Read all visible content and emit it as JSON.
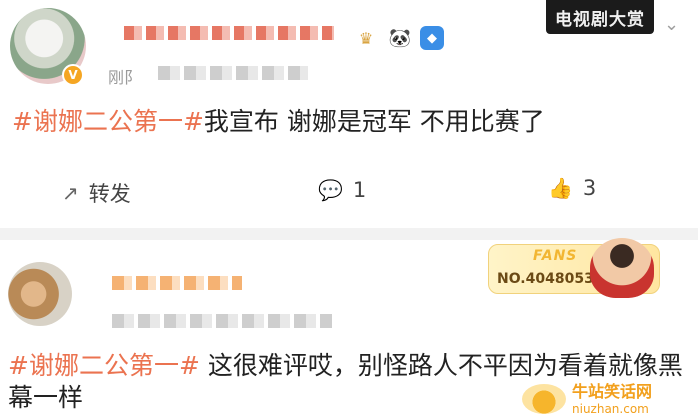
{
  "post1": {
    "time_partial": "刚阝",
    "award_logo_text": "电视剧大赏",
    "content_tag": "#谢娜二公第一#",
    "content_text": "我宣布 谢娜是冠军 不用比赛了",
    "actions": {
      "repost_label": "转发",
      "comment_count": "1",
      "like_count": "3"
    },
    "icons": [
      "repost-icon",
      "comment-icon",
      "like-icon",
      "chevron-down-icon",
      "gold-badge-icon",
      "panda-icon",
      "blue-v-icon"
    ]
  },
  "post2": {
    "fans_label": "FANS",
    "fans_number": "NO.4048053",
    "content_tag": "#谢娜二公第一#",
    "content_text": " 这很难评哎，别怪路人不平因为看着就像黑幕一样"
  },
  "watermark": {
    "cn": "牛站笑话网",
    "url": "niuzhan.com"
  }
}
